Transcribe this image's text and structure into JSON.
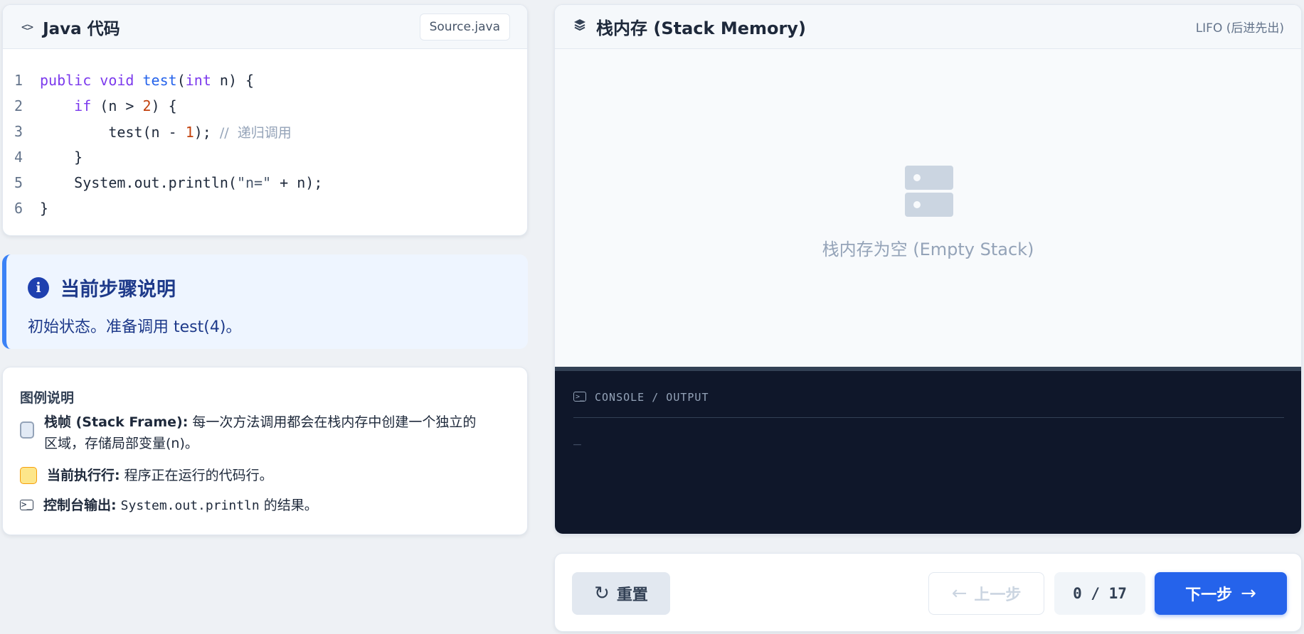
{
  "code_panel": {
    "title": "Java 代码",
    "icon": "code-icon",
    "file_badge": "Source.java",
    "lines": [
      {
        "no": "1",
        "text": "public void test(int n) {"
      },
      {
        "no": "2",
        "text": "    if (n > 2) {"
      },
      {
        "no": "3",
        "text": "        test(n - 1); // 递归调用"
      },
      {
        "no": "4",
        "text": "    }"
      },
      {
        "no": "5",
        "text": "    System.out.println(\"n=\" + n);"
      },
      {
        "no": "6",
        "text": "}"
      }
    ]
  },
  "step": {
    "icon": "info-icon",
    "title": "当前步骤说明",
    "description": "初始状态。准备调用 test(4)。"
  },
  "legend": {
    "title": "图例说明",
    "items": [
      {
        "icon": "stack-frame-swatch",
        "label": "栈帧 (Stack Frame):",
        "text_line1": "每一次方法调用都会在栈内存中创建一个独立的",
        "text_line2": "区域，存储局部变量(n)。",
        "color": "#e2eaf5"
      },
      {
        "icon": "current-line-swatch",
        "label": "当前执行行:",
        "text": "程序正在运行的代码行。",
        "color": "#fde68a"
      },
      {
        "icon": "terminal-icon",
        "label": "控制台输出:",
        "code": "System.out.println",
        "text": "的结果。"
      }
    ]
  },
  "stack_panel": {
    "icon": "layers-icon",
    "title": "栈内存 (Stack Memory)",
    "badge": "LIFO (后进先出)",
    "empty_text": "栈内存为空 (Empty Stack)"
  },
  "console": {
    "title": "CONSOLE / OUTPUT",
    "cursor": "_"
  },
  "controls": {
    "reset_label": "重置",
    "prev_label": "上一步",
    "next_label": "下一步",
    "counter": "0 / 17",
    "accent_color": "#2563eb"
  }
}
